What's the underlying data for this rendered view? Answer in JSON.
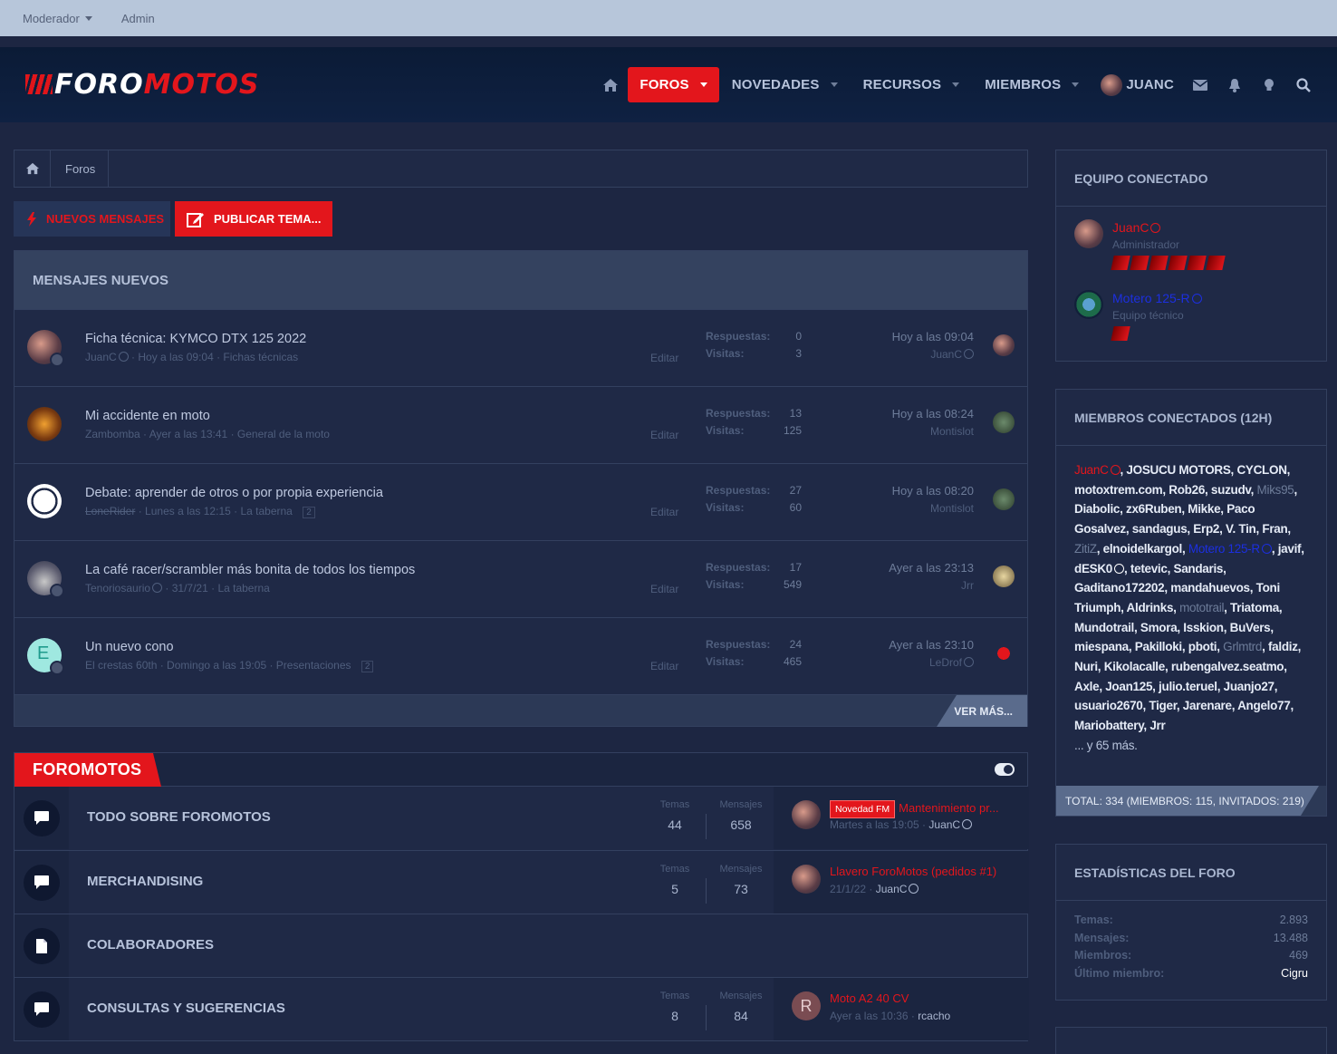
{
  "topbar": {
    "moderator": "Moderador",
    "admin": "Admin"
  },
  "brand": {
    "logo_part1": "FORO",
    "logo_part2": "MOTOS",
    "accent": "#e3161c"
  },
  "nav": {
    "foros": "FOROS",
    "novedades": "NOVEDADES",
    "recursos": "RECURSOS",
    "miembros": "MIEMBROS",
    "user": "JUANC",
    "icons": [
      "home-icon",
      "envelope-icon",
      "bell-icon",
      "lightbulb-icon",
      "search-icon"
    ]
  },
  "breadcrumb": {
    "item": "Foros"
  },
  "actions": {
    "new_messages": "NUEVOS MENSAJES",
    "publish": "PUBLICAR TEMA..."
  },
  "new_posts": {
    "title": "MENSAJES NUEVOS",
    "edit_label": "Editar",
    "replies_label": "Respuestas:",
    "views_label": "Visitas:",
    "more": "VER MÁS...",
    "threads": [
      {
        "title": "Ficha técnica: KYMCO DTX 125 2022",
        "author": "JuanC",
        "date": "Hoy a las 09:04",
        "forum": "Fichas técnicas",
        "replies": "0",
        "views": "3",
        "last_date": "Hoy a las 09:04",
        "last_user": "JuanC"
      },
      {
        "title": "Mi accidente en moto",
        "author": "Zambomba",
        "date": "Ayer a las 13:41",
        "forum": "General de la moto",
        "replies": "13",
        "views": "125",
        "last_date": "Hoy a las 08:24",
        "last_user": "Montislot"
      },
      {
        "title": "Debate: aprender de otros o por propia experiencia",
        "author": "LoneRider",
        "date": "Lunes a las 12:15",
        "forum": "La taberna",
        "page": "2",
        "replies": "27",
        "views": "60",
        "last_date": "Hoy a las 08:20",
        "last_user": "Montislot"
      },
      {
        "title": "La café racer/scrambler más bonita de todos los tiempos",
        "author": "Tenoriosaurio",
        "date": "31/7/21",
        "forum": "La taberna",
        "replies": "17",
        "views": "549",
        "last_date": "Ayer a las 23:13",
        "last_user": "Jrr"
      },
      {
        "title": "Un nuevo cono",
        "author": "El crestas 60th",
        "date": "Domingo a las 19:05",
        "forum": "Presentaciones",
        "page": "2",
        "replies": "24",
        "views": "465",
        "last_date": "Ayer a las 23:10",
        "last_user": "LeDrof"
      }
    ]
  },
  "category": {
    "title": "FOROMOTOS",
    "themes_label": "Temas",
    "messages_label": "Mensajes",
    "forums": [
      {
        "name": "TODO SOBRE FOROMOTOS",
        "themes": "44",
        "messages": "658",
        "badge": "Novedad FM",
        "last_title": "Mantenimiento pr...",
        "last_date": "Martes a las 19:05",
        "last_user": "JuanC"
      },
      {
        "name": "MERCHANDISING",
        "themes": "5",
        "messages": "73",
        "last_title": "Llavero ForoMotos (pedidos #1)",
        "last_date": "21/1/22",
        "last_user": "JuanC"
      },
      {
        "name": "COLABORADORES"
      },
      {
        "name": "CONSULTAS Y SUGERENCIAS",
        "themes": "8",
        "messages": "84",
        "avatar_letter": "R",
        "last_title": "Moto A2 40 CV",
        "last_date": "Ayer a las 10:36",
        "last_user": "rcacho"
      }
    ]
  },
  "sidebar": {
    "staff_title": "EQUIPO CONECTADO",
    "staff": [
      {
        "name": "JuanC",
        "role": "Administrador",
        "bars": 6,
        "color": "#e3161c"
      },
      {
        "name": "Motero 125-R",
        "role": "Equipo técnico",
        "bars": 1,
        "color": "#1c2fe0"
      }
    ],
    "online_title": "MIEMBROS CONECTADOS (12H)",
    "online_more": "... y 65 más.",
    "online_total": "TOTAL: 334 (MIEMBROS: 115, INVITADOS: 219)",
    "stats_title": "ESTADÍSTICAS DEL FORO",
    "stats": [
      {
        "label": "Temas:",
        "value": "2.893"
      },
      {
        "label": "Mensajes:",
        "value": "13.488"
      },
      {
        "label": "Miembros:",
        "value": "469"
      },
      {
        "label": "Último miembro:",
        "value": "Cigru"
      }
    ]
  }
}
